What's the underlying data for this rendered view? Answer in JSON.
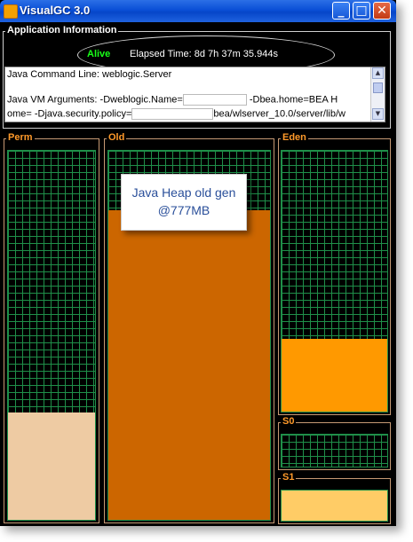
{
  "window": {
    "title": "VisualGC 3.0"
  },
  "title_buttons": {
    "minimize": "_",
    "maximize": "□",
    "close": "✕"
  },
  "app_info": {
    "group_title": "Application Information",
    "status": "Alive",
    "elapsed_time": "Elapsed Time:  8d 7h 37m 35.944s",
    "command_line": "Java Command Line: weblogic.Server",
    "vm_args_line1_a": "Java VM Arguments: -Dweblogic.Name=",
    "vm_args_line1_b": " -Dbea.home=BEA H",
    "vm_args_line2_a": "ome= -Djava.security.policy=",
    "vm_args_line2_b": "bea/wlserver_10.0/server/lib/w"
  },
  "panels": {
    "perm": {
      "label": "Perm",
      "used_fraction": 0.29
    },
    "old": {
      "label": "Old",
      "used_fraction": 0.84
    },
    "eden": {
      "label": "Eden",
      "used_fraction": 0.28
    },
    "s0": {
      "label": "S0",
      "used_fraction": 0.0
    },
    "s1": {
      "label": "S1",
      "used_fraction": 1.0
    }
  },
  "annotation": {
    "line1": "Java Heap old gen",
    "line2": "@777MB"
  },
  "colors": {
    "perm_fill": "#eecba3",
    "old_fill": "#cc6600",
    "eden_fill": "#ff9900",
    "s1_fill": "#ffcc66",
    "grid": "#1f8f49",
    "label": "#ff9a2a",
    "alive": "#18ff18"
  }
}
